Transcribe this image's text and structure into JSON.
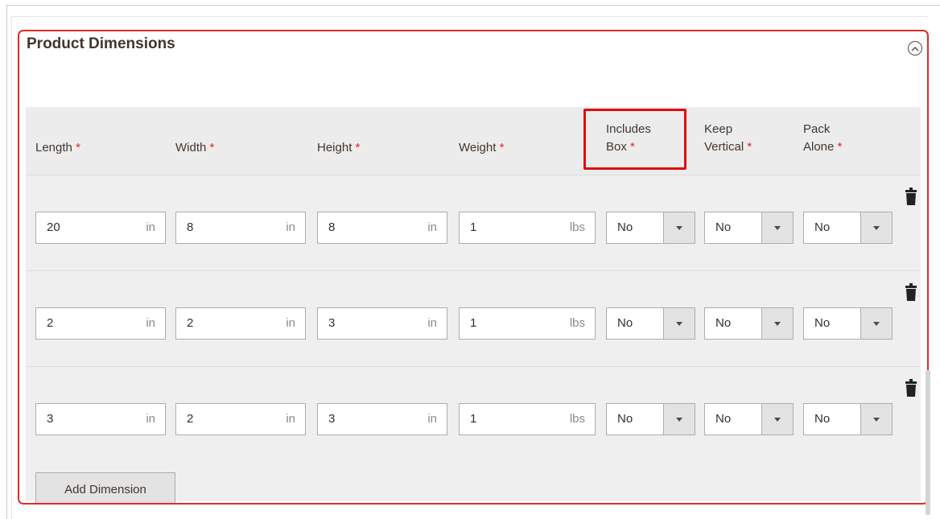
{
  "panel": {
    "title": "Product Dimensions"
  },
  "headers": {
    "length": "Length",
    "width": "Width",
    "height": "Height",
    "weight": "Weight",
    "includes_box_line1": "Includes",
    "includes_box_line2": "Box",
    "keep_vertical_line1": "Keep",
    "keep_vertical_line2": "Vertical",
    "pack_alone_line1": "Pack",
    "pack_alone_line2": "Alone",
    "required_mark": "*"
  },
  "units": {
    "dimension": "in",
    "weight": "lbs"
  },
  "rows": [
    {
      "length": "20",
      "width": "8",
      "height": "8",
      "weight": "1",
      "includes_box": "No",
      "keep_vertical": "No",
      "pack_alone": "No"
    },
    {
      "length": "2",
      "width": "2",
      "height": "3",
      "weight": "1",
      "includes_box": "No",
      "keep_vertical": "No",
      "pack_alone": "No"
    },
    {
      "length": "3",
      "width": "2",
      "height": "3",
      "weight": "1",
      "includes_box": "No",
      "keep_vertical": "No",
      "pack_alone": "No"
    }
  ],
  "add_button_label": "Add Dimension",
  "icons": {
    "collapse": "chevron-up-circle-icon",
    "delete": "trash-icon",
    "select_arrow": "caret-down-icon"
  },
  "colors": {
    "required": "#e22626",
    "highlight_border": "#e00d0d",
    "panel_border": "#e02b27"
  }
}
